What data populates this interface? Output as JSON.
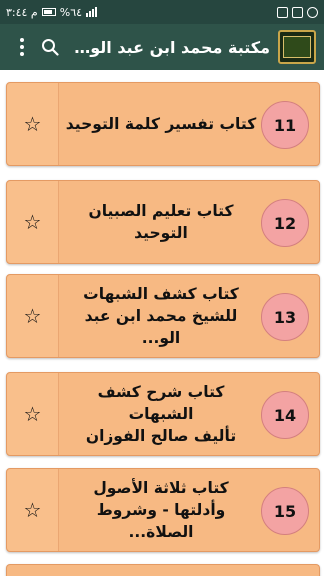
{
  "status_bar": {
    "time": "م ٣:٤٤",
    "battery": "%٦٤"
  },
  "app_bar": {
    "title": "مكتبة محمد ابن عبد الوه..."
  },
  "books": [
    {
      "number": "11",
      "title": "كتاب تفسير كلمة التوحيد"
    },
    {
      "number": "12",
      "title": "كتاب تعليم الصبيان\nالتوحيد"
    },
    {
      "number": "13",
      "title": "كتاب كشف الشبهات\nللشيخ محمد ابن عبد الو..."
    },
    {
      "number": "14",
      "title": "كتاب شرح كشف الشبهات\nتأليف صالح الفوزان"
    },
    {
      "number": "15",
      "title": "كتاب ثلاثة الأصول\nوأدلتها - وشروط الصلاة..."
    }
  ]
}
